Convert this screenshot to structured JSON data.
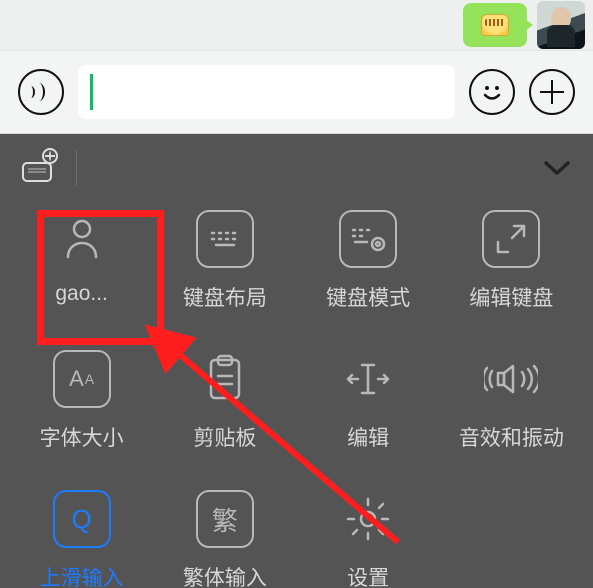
{
  "chat": {
    "bubble_emoji": "grin-emoji",
    "avatar": "user-avatar"
  },
  "input_bar": {
    "voice_button": "voice-input",
    "text_value": "",
    "emoji_button": "emoji-picker",
    "more_button": "more-actions"
  },
  "panel_top": {
    "keyboard_switch": "keyboard-language-switch",
    "collapse": "collapse-panel"
  },
  "grid": [
    {
      "id": "account",
      "label": "gao...",
      "icon": "person-icon",
      "active": false,
      "boxed": false
    },
    {
      "id": "layout",
      "label": "键盘布局",
      "icon": "keyboard-icon",
      "active": false,
      "boxed": true
    },
    {
      "id": "mode",
      "label": "键盘模式",
      "icon": "keyboard-gear-icon",
      "active": false,
      "boxed": true
    },
    {
      "id": "editkb",
      "label": "编辑键盘",
      "icon": "resize-icon",
      "active": false,
      "boxed": true
    },
    {
      "id": "fontsize",
      "label": "字体大小",
      "icon": "font-size-icon",
      "active": false,
      "boxed": true
    },
    {
      "id": "clipboard",
      "label": "剪贴板",
      "icon": "clipboard-icon",
      "active": false,
      "boxed": false
    },
    {
      "id": "edit",
      "label": "编辑",
      "icon": "text-cursor-icon",
      "active": false,
      "boxed": false
    },
    {
      "id": "soundvib",
      "label": "音效和振动",
      "icon": "vibration-icon",
      "active": false,
      "boxed": false
    },
    {
      "id": "swipe",
      "label": "上滑输入",
      "icon": "q-key-icon",
      "active": true,
      "boxed": true
    },
    {
      "id": "trad",
      "label": "繁体输入",
      "icon": "traditional-icon",
      "active": false,
      "boxed": true
    },
    {
      "id": "settings",
      "label": "设置",
      "icon": "gear-icon",
      "active": false,
      "boxed": false
    }
  ],
  "annotation": {
    "highlight_target": "account",
    "arrow_from": "settings",
    "arrow_color": "#ff1e1e"
  }
}
